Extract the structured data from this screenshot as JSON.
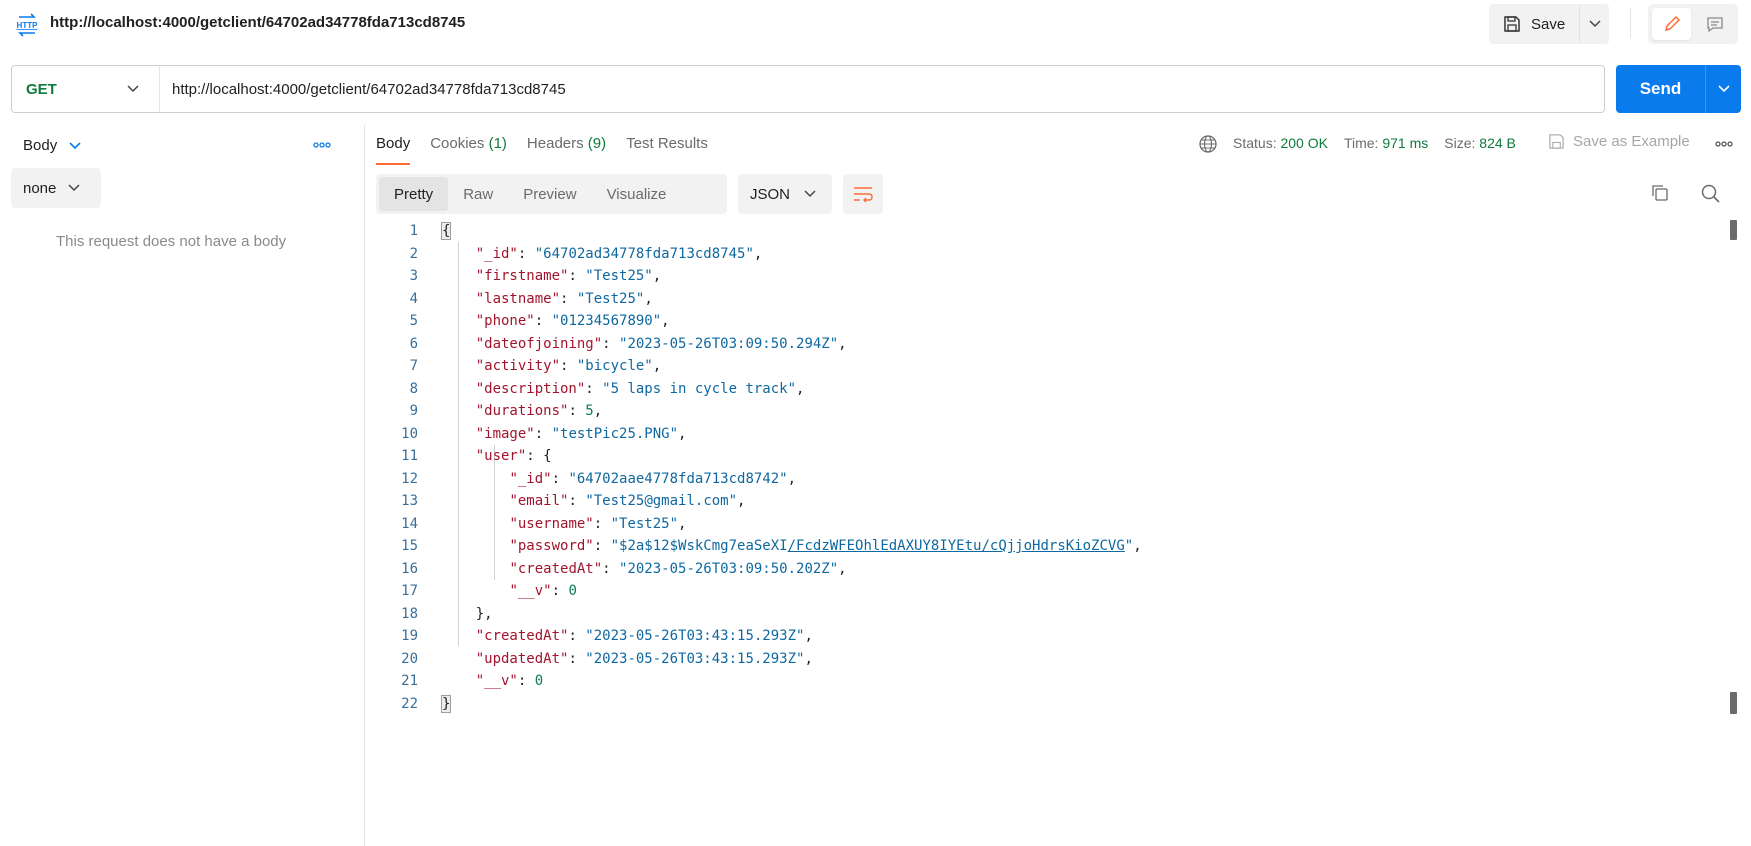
{
  "header": {
    "request_title": "http://localhost:4000/getclient/64702ad34778fda713cd8745",
    "save_label": "Save"
  },
  "request": {
    "method": "GET",
    "url": "http://localhost:4000/getclient/64702ad34778fda713cd8745",
    "send_label": "Send"
  },
  "request_body": {
    "tab_label": "Body",
    "body_type": "none",
    "empty_message": "This request does not have a body"
  },
  "response": {
    "tabs": [
      {
        "label": "Body",
        "count": ""
      },
      {
        "label": "Cookies",
        "count": "(1)"
      },
      {
        "label": "Headers",
        "count": "(9)"
      },
      {
        "label": "Test Results",
        "count": ""
      }
    ],
    "status_label": "Status:",
    "status_value": "200 OK",
    "time_label": "Time:",
    "time_value": "971 ms",
    "size_label": "Size:",
    "size_value": "824 B",
    "save_example_label": "Save as Example",
    "view_modes": [
      "Pretty",
      "Raw",
      "Preview",
      "Visualize"
    ],
    "format": "JSON"
  },
  "code_lines": [
    {
      "n": "1",
      "k": "",
      "v": "",
      "open": "{"
    },
    {
      "n": "2",
      "k": "\"_id\"",
      "v": "\"64702ad34778fda713cd8745\""
    },
    {
      "n": "3",
      "k": "\"firstname\"",
      "v": "\"Test25\""
    },
    {
      "n": "4",
      "k": "\"lastname\"",
      "v": "\"Test25\""
    },
    {
      "n": "5",
      "k": "\"phone\"",
      "v": "\"01234567890\""
    },
    {
      "n": "6",
      "k": "\"dateofjoining\"",
      "v": "\"2023-05-26T03:09:50.294Z\""
    },
    {
      "n": "7",
      "k": "\"activity\"",
      "v": "\"bicycle\""
    },
    {
      "n": "8",
      "k": "\"description\"",
      "v": "\"5 laps in cycle track\""
    },
    {
      "n": "9",
      "k": "\"durations\"",
      "v": "5"
    },
    {
      "n": "10",
      "k": "\"image\"",
      "v": "\"testPic25.PNG\""
    },
    {
      "n": "11",
      "k": "\"user\"",
      "v": "{"
    },
    {
      "n": "12",
      "k": "\"_id\"",
      "v": "\"64702aae4778fda713cd8742\""
    },
    {
      "n": "13",
      "k": "\"email\"",
      "v": "\"Test25@gmail.com\""
    },
    {
      "n": "14",
      "k": "\"username\"",
      "v": "\"Test25\""
    },
    {
      "n": "15",
      "k": "\"password\"",
      "v": "\"$2a$12$WskCmg7eaSeXI",
      "v2": "/FcdzWFEOhlEdAXUY8IYEtu/cQjjoHdrsKioZCVG",
      "v3": "\""
    },
    {
      "n": "16",
      "k": "\"createdAt\"",
      "v": "\"2023-05-26T03:09:50.202Z\""
    },
    {
      "n": "17",
      "k": "\"__v\"",
      "v": "0"
    },
    {
      "n": "18",
      "k": "",
      "v": "},"
    },
    {
      "n": "19",
      "k": "\"createdAt\"",
      "v": "\"2023-05-26T03:43:15.293Z\""
    },
    {
      "n": "20",
      "k": "\"updatedAt\"",
      "v": "\"2023-05-26T03:43:15.293Z\""
    },
    {
      "n": "21",
      "k": "\"__v\"",
      "v": "0"
    },
    {
      "n": "22",
      "k": "",
      "v": "",
      "open": "}"
    }
  ]
}
